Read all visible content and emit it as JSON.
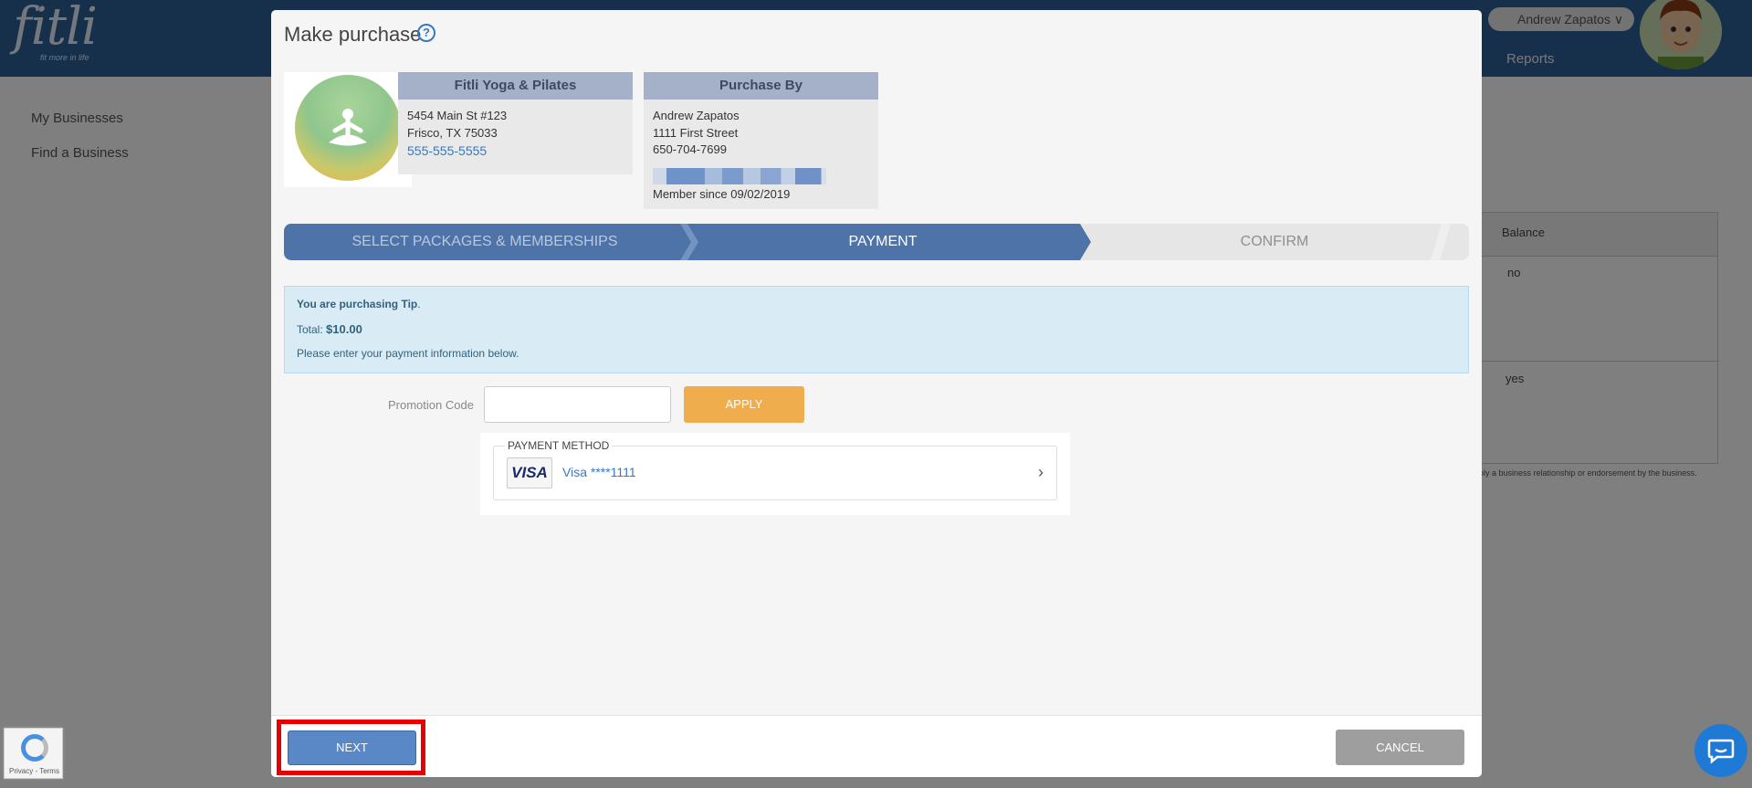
{
  "app": {
    "logo": "fitli",
    "logo_tagline": "fit more in life",
    "user_name": "Andrew Zapatos",
    "reports_link": "Reports",
    "sidebar": [
      "My Businesses",
      "Find a Business"
    ],
    "table": {
      "balance_header": "Balance",
      "rows": [
        "no",
        "yes"
      ]
    },
    "disclaimer": "ply a business relationship or endorsement by the business."
  },
  "modal": {
    "title": "Make purchase",
    "help_icon": "?",
    "business": {
      "header": "Fitli Yoga & Pilates",
      "address1": "5454 Main St #123",
      "address2": "Frisco, TX 75033",
      "phone": "555-555-5555",
      "logo_text": "FITLI YOGA & PILATES"
    },
    "purchaser": {
      "header": "Purchase By",
      "name": "Andrew Zapatos",
      "street": "1111 First Street",
      "phone": "650-704-7699",
      "member_since": "Member since 09/02/2019"
    },
    "steps": [
      "SELECT PACKAGES & MEMBERSHIPS",
      "PAYMENT",
      "CONFIRM"
    ],
    "active_step": 1,
    "summary": {
      "purchasing_prefix": "You are purchasing",
      "item": "Tip",
      "total_label": "Total:",
      "total_value": "$10.00",
      "instruction": "Please enter your payment information below."
    },
    "promo": {
      "label": "Promotion Code",
      "value": "",
      "apply_label": "APPLY"
    },
    "payment_method": {
      "legend": "PAYMENT METHOD",
      "card_brand": "VISA",
      "card_text": "Visa ****1111",
      "chevron": "›"
    },
    "footer": {
      "next_label": "NEXT",
      "cancel_label": "CANCEL"
    }
  },
  "recaptcha": {
    "text": "Privacy - Terms"
  },
  "colors": {
    "topbar": "#2d5f97",
    "step_active": "#4e73a8",
    "apply": "#f0ad4e",
    "next": "#5a87c5",
    "cancel": "#9e9e9e",
    "highlight": "#e60000"
  }
}
